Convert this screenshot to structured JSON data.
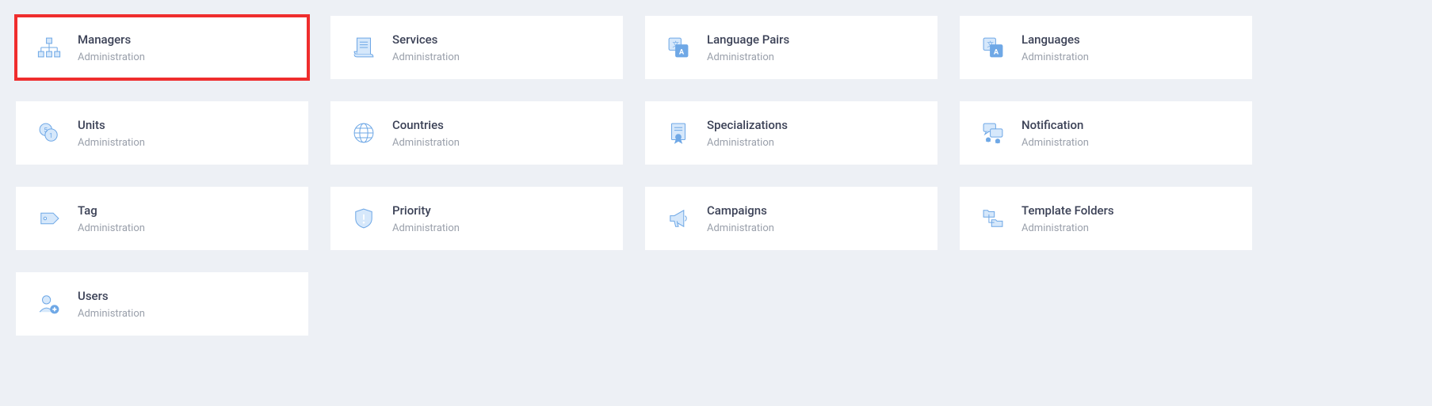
{
  "cards": [
    {
      "title": "Managers",
      "subtitle": "Administration",
      "icon": "org-chart",
      "highlighted": true
    },
    {
      "title": "Services",
      "subtitle": "Administration",
      "icon": "scroll",
      "highlighted": false
    },
    {
      "title": "Language Pairs",
      "subtitle": "Administration",
      "icon": "translate",
      "highlighted": false
    },
    {
      "title": "Languages",
      "subtitle": "Administration",
      "icon": "translate",
      "highlighted": false
    },
    {
      "title": "Units",
      "subtitle": "Administration",
      "icon": "coins",
      "highlighted": false
    },
    {
      "title": "Countries",
      "subtitle": "Administration",
      "icon": "globe",
      "highlighted": false
    },
    {
      "title": "Specializations",
      "subtitle": "Administration",
      "icon": "certificate",
      "highlighted": false
    },
    {
      "title": "Notification",
      "subtitle": "Administration",
      "icon": "chat",
      "highlighted": false
    },
    {
      "title": "Tag",
      "subtitle": "Administration",
      "icon": "tag",
      "highlighted": false
    },
    {
      "title": "Priority",
      "subtitle": "Administration",
      "icon": "shield",
      "highlighted": false
    },
    {
      "title": "Campaigns",
      "subtitle": "Administration",
      "icon": "megaphone",
      "highlighted": false
    },
    {
      "title": "Template Folders",
      "subtitle": "Administration",
      "icon": "folders",
      "highlighted": false
    },
    {
      "title": "Users",
      "subtitle": "Administration",
      "icon": "users",
      "highlighted": false
    }
  ]
}
